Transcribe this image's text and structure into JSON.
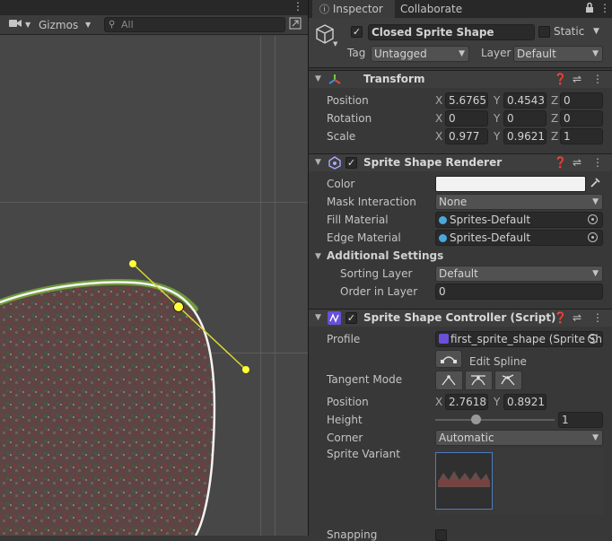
{
  "scene": {
    "camera_icon": "camera-icon",
    "gizmos_label": "Gizmos",
    "search_placeholder": "All"
  },
  "tabs": [
    {
      "label": "Inspector",
      "icon": "info-icon",
      "active": true
    },
    {
      "label": "Collaborate",
      "active": false
    }
  ],
  "object": {
    "enabled": true,
    "name": "Closed Sprite Shape",
    "static_label": "Static",
    "static_checked": false,
    "tag_label": "Tag",
    "tag_value": "Untagged",
    "layer_label": "Layer",
    "layer_value": "Default"
  },
  "transform": {
    "title": "Transform",
    "position_label": "Position",
    "position": {
      "x": "5.6765",
      "y": "0.4543",
      "z": "0"
    },
    "rotation_label": "Rotation",
    "rotation": {
      "x": "0",
      "y": "0",
      "z": "0"
    },
    "scale_label": "Scale",
    "scale": {
      "x": "0.977",
      "y": "0.9621",
      "z": "1"
    }
  },
  "renderer": {
    "title": "Sprite Shape Renderer",
    "enabled": true,
    "color_label": "Color",
    "color_value": "#f2f2f2",
    "mask_label": "Mask Interaction",
    "mask_value": "None",
    "fill_label": "Fill Material",
    "fill_value": "Sprites-Default",
    "edge_label": "Edge Material",
    "edge_value": "Sprites-Default",
    "additional_label": "Additional Settings",
    "sorting_label": "Sorting Layer",
    "sorting_value": "Default",
    "order_label": "Order in Layer",
    "order_value": "0"
  },
  "controller": {
    "title": "Sprite Shape Controller (Script)",
    "enabled": true,
    "profile_label": "Profile",
    "profile_value": "first_sprite_shape (Sprite Sh",
    "edit_spline_label": "Edit Spline",
    "tangent_label": "Tangent Mode",
    "position_label": "Position",
    "position": {
      "x": "2.76189",
      "y": "0.89215"
    },
    "height_label": "Height",
    "height_value": "1",
    "height_slider": 0.33,
    "corner_label": "Corner",
    "corner_value": "Automatic",
    "variant_label": "Sprite Variant",
    "variant_index": "0",
    "snapping_label": "Snapping"
  },
  "axes": {
    "x": "X",
    "y": "Y",
    "z": "Z"
  },
  "colors": {
    "accent": "#4c7dbd",
    "handle": "#ffff3a",
    "tangent_line": "#d9d933"
  }
}
